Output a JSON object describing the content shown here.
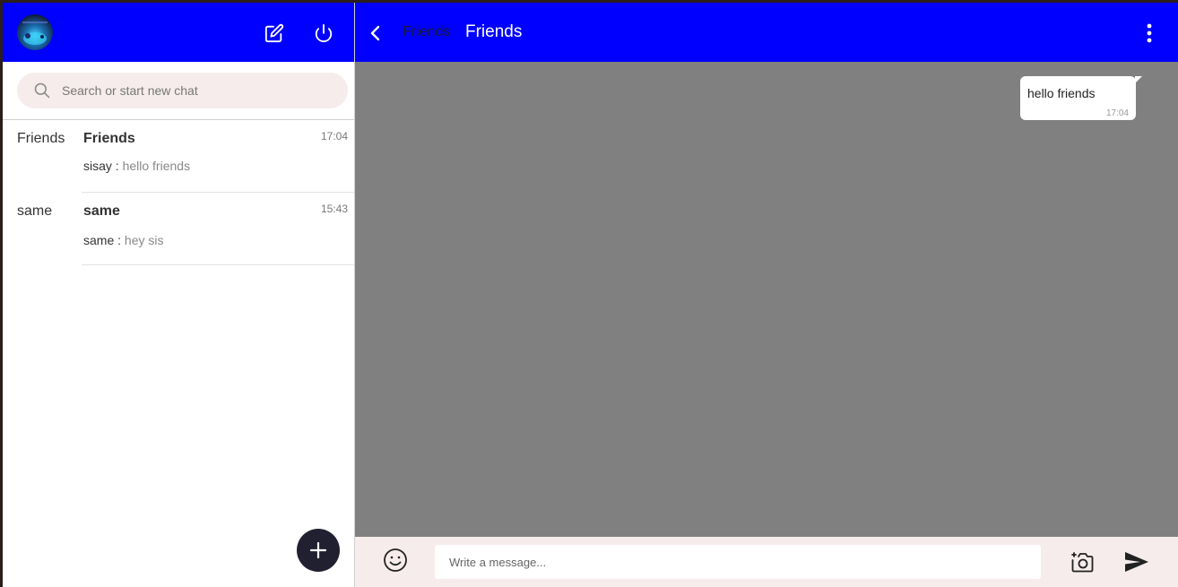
{
  "sidebar": {
    "search": {
      "placeholder": "Search or start new chat"
    },
    "chats": [
      {
        "avatar_text": "Friends",
        "name": "Friends",
        "time": "17:04",
        "sender": "sisay",
        "separator": " : ",
        "message": "hello friends"
      },
      {
        "avatar_text": "same",
        "name": "same",
        "time": "15:43",
        "sender": "same",
        "separator": " : ",
        "message": "hey sis"
      }
    ]
  },
  "conversation": {
    "header": {
      "avatar_text": "Friends",
      "title": "Friends"
    },
    "messages": [
      {
        "text": "hello friends",
        "time": "17:04"
      }
    ],
    "composer": {
      "placeholder": "Write a message..."
    }
  },
  "icons": {
    "new_chat": "edit-icon",
    "logout": "power-icon",
    "search": "search-icon",
    "add": "plus-icon",
    "back": "chevron-left-icon",
    "more": "more-vertical-icon",
    "emoji": "smiley-icon",
    "camera": "camera-add-icon",
    "send": "send-icon"
  },
  "colors": {
    "header_bg": "#0000ff",
    "chat_bg": "#808080",
    "composer_bg": "#f5eceb",
    "fab_bg": "#202030"
  }
}
